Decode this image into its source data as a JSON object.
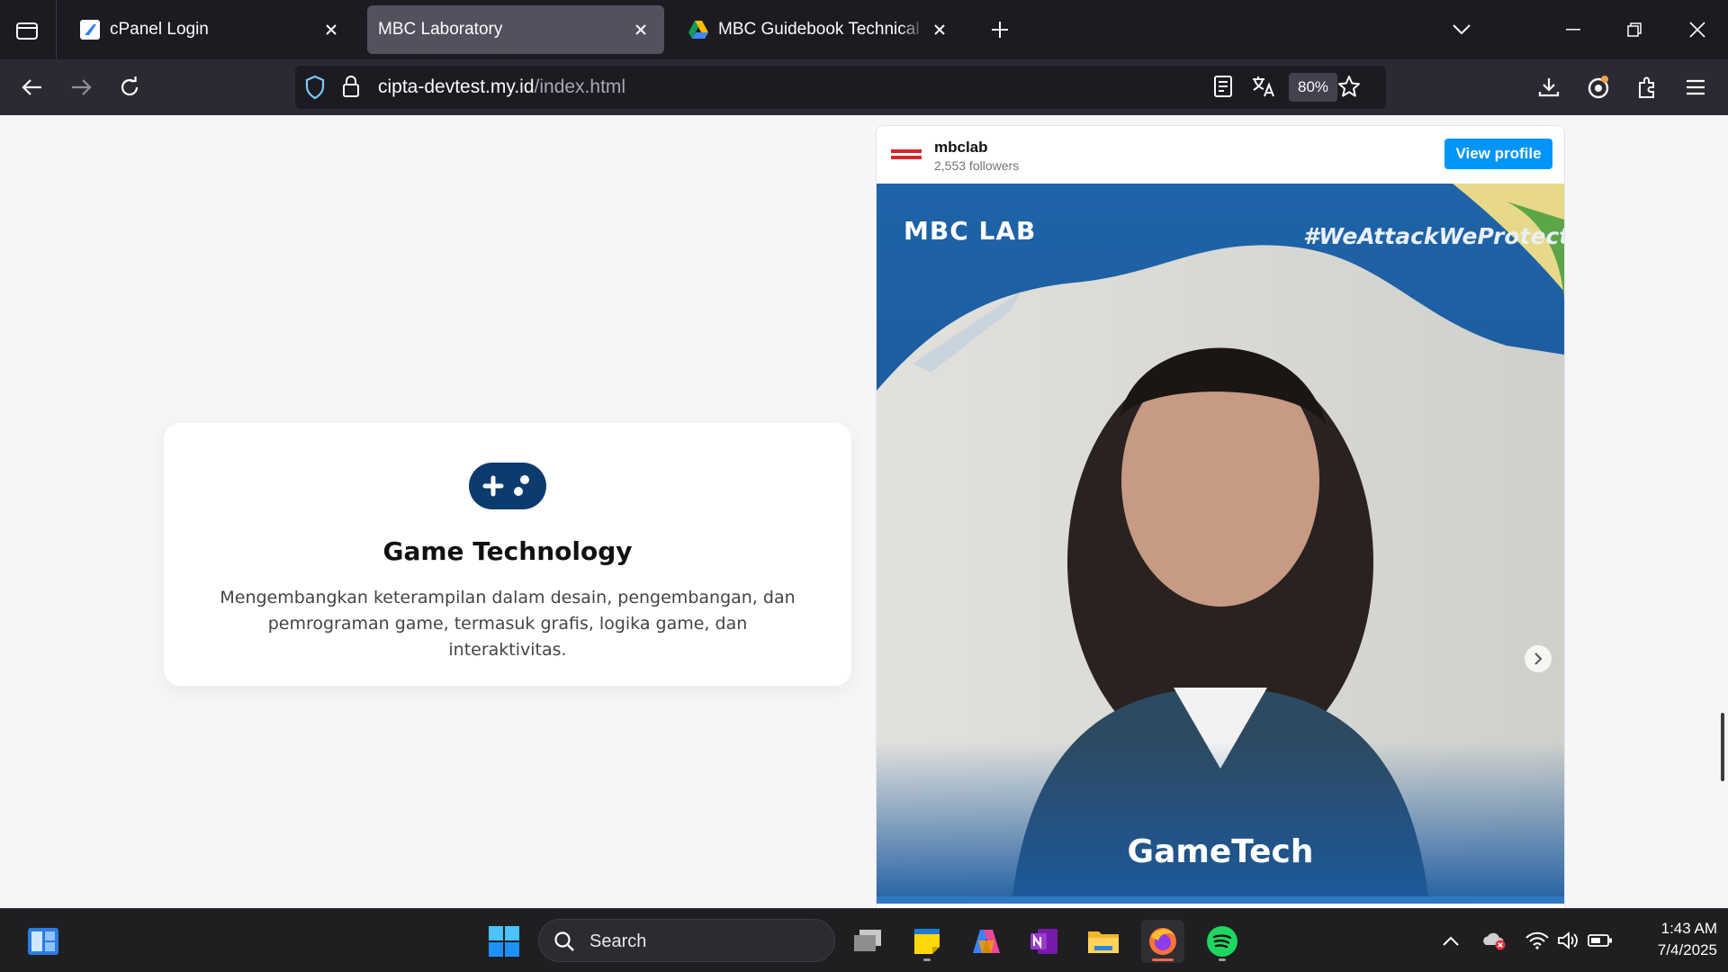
{
  "browser": {
    "tabs": [
      {
        "title": "cPanel Login",
        "favicon": "cpanel-favicon",
        "active": false
      },
      {
        "title": "MBC Laboratory",
        "favicon": "none",
        "active": true
      },
      {
        "title": "MBC Guidebook Technical Test - Google Drive",
        "favicon": "google-drive-favicon",
        "active": false
      }
    ],
    "url_host": "cipta-devtest.my.id",
    "url_path": "/index.html",
    "zoom": "80%"
  },
  "page": {
    "card": {
      "icon": "gamepad-icon",
      "title": "Game Technology",
      "description": "Mengembangkan keterampilan dalam desain, pengembangan, dan pemrograman game, termasuk grafis, logika game, dan interaktivitas."
    },
    "instagram": {
      "username": "mbclab",
      "followers": "2,553 followers",
      "view_profile": "View profile",
      "media": {
        "logo_text": "MBC LAB",
        "hashtag": "#WeAttackWeProtect",
        "caption": "GameTech"
      }
    }
  },
  "taskbar": {
    "search_placeholder": "Search",
    "time": "1:43 AM",
    "date": "7/4/2025"
  },
  "colors": {
    "accent_blue": "#0095f6",
    "card_icon": "#0d3b6e",
    "media_blue": "#1f63a8"
  }
}
